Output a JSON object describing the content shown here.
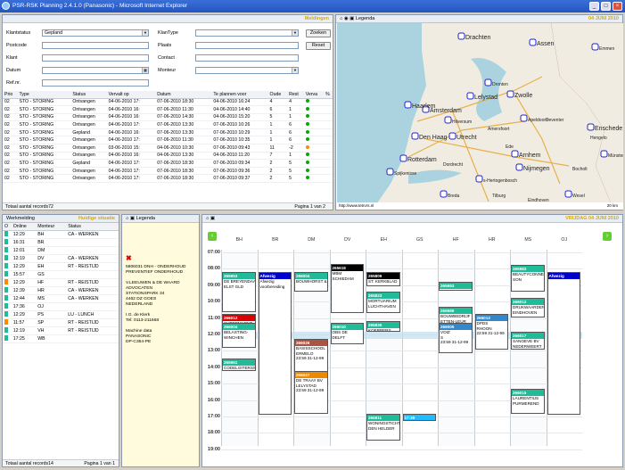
{
  "window": {
    "title": "PSR-RSK Planning 2.4.1.0 (Panasonic) - Microsoft Internet Explorer"
  },
  "search": {
    "meldingen": "Meldingen",
    "klantstatus_label": "Klantstatus",
    "klantstatus_value": "Gepland",
    "postcode_label": "Postcode",
    "klant_label": "Klant",
    "datum_label": "Datum",
    "refnr_label": "Ref.nr.",
    "klantype_label": "KlanType",
    "plaats_label": "Plaats",
    "contact_label": "Contact",
    "monteur_label": "Monteur",
    "zoeken": "Zoeken",
    "reset": "Reset"
  },
  "joblist": {
    "headers": [
      "Prio",
      "Type",
      "Status",
      "Vervalt op",
      "Datum",
      "Te plannen voor",
      "Oude",
      "Rest",
      "Verva",
      "%"
    ],
    "rows": [
      [
        "02",
        "STO - STORING",
        "Ontvangen",
        "04-06-2010 17:",
        "07-06-2010 18:30",
        "04-06-2010 16:24",
        "4",
        "4"
      ],
      [
        "02",
        "STO - STORING",
        "Ontvangen",
        "04-06-2010 16:",
        "07-06-2010 11:30",
        "04-06-2010 14:40",
        "6",
        "1"
      ],
      [
        "02",
        "STO - STORING",
        "Ontvangen",
        "04-06-2010 16:",
        "07-06-2010 14:30",
        "04-06-2010 15:20",
        "5",
        "1"
      ],
      [
        "02",
        "STO - STORING",
        "Ontvangen",
        "04-06-2010 17:",
        "07-06-2010 13:30",
        "07-06-2010 10:26",
        "1",
        "6"
      ],
      [
        "02",
        "STO - STORING",
        "Gepland",
        "04-06-2010 16:",
        "07-06-2010 13:30",
        "07-06-2010 10:29",
        "1",
        "6"
      ],
      [
        "02",
        "STO - STORING",
        "Ontvangen",
        "04-06-2010 17:",
        "07-06-2010 11:30",
        "07-06-2010 10:35",
        "1",
        "6"
      ],
      [
        "02",
        "STO - STORING",
        "Ontvangen",
        "03-06-2010 15:",
        "04-06-2010 10:30",
        "07-06-2010 09:43",
        "11",
        "-2"
      ],
      [
        "02",
        "STO - STORING",
        "Ontvangen",
        "04-06-2010 16:",
        "04-06-2010 13:30",
        "04-06-2010 11:20",
        "7",
        "1"
      ],
      [
        "02",
        "STO - STORING",
        "Gepland",
        "04-06-2010 17:",
        "07-06-2010 18:30",
        "07-06-2010 09:34",
        "2",
        "5"
      ],
      [
        "02",
        "STO - STORING",
        "Ontvangen",
        "04-06-2010 17:",
        "07-06-2010 18:30",
        "07-06-2010 09:36",
        "2",
        "5"
      ],
      [
        "02",
        "STO - STORING",
        "Ontvangen",
        "04-06-2010 17:",
        "07-06-2010 18:30",
        "07-06-2010 09:37",
        "2",
        "5"
      ]
    ],
    "dots": [
      "#0a0",
      "#0a0",
      "#0a0",
      "#0a0",
      "#0a0",
      "#0a0",
      "#f80",
      "#0a0",
      "#0a0",
      "#0a0",
      "#0a0"
    ],
    "footer": "Totaal aantal records72",
    "pager": "Pagina 1 van 2"
  },
  "map": {
    "date": "04 JUNI 2010",
    "legend": "Legenda",
    "status": "http://www.tetrvrs.nl",
    "scale": "20 km",
    "cities": [
      {
        "n": "Assen"
      },
      {
        "n": "Drachten"
      },
      {
        "n": "Zwolle"
      },
      {
        "n": "Lelystad"
      },
      {
        "n": "Amsterdam"
      },
      {
        "n": "Haarlem"
      },
      {
        "n": "Den Haag"
      },
      {
        "n": "Utrecht"
      },
      {
        "n": "Rotterdam"
      },
      {
        "n": "Arnhem"
      },
      {
        "n": "Nijmegen"
      },
      {
        "n": "Enschede"
      },
      {
        "n": "Apeldoorn"
      },
      {
        "n": "Deventer"
      },
      {
        "n": "Emmen"
      },
      {
        "n": "Hengelo"
      },
      {
        "n": "Münster"
      },
      {
        "n": "Dordrecht"
      },
      {
        "n": "s-Hertogenbosch"
      },
      {
        "n": "Tilburg"
      },
      {
        "n": "Breda"
      },
      {
        "n": "Eindhoven"
      },
      {
        "n": "Wesel"
      },
      {
        "n": "Bocholt"
      },
      {
        "n": "Spijkenisse"
      },
      {
        "n": "Ede"
      },
      {
        "n": "Dronten"
      },
      {
        "n": "Amersfoort"
      },
      {
        "n": "Hilversum"
      }
    ]
  },
  "engineers": {
    "title": "Werkmelding",
    "gold": "Huidige situatie",
    "headers": [
      "O",
      "Online",
      "Monteur",
      "Status"
    ],
    "rows": [
      [
        "12:29",
        "BH",
        "CA - WERKEN",
        "#2b9"
      ],
      [
        "16:31",
        "BR",
        "",
        "#2b9"
      ],
      [
        "12:01",
        "DM",
        "",
        "#2b9"
      ],
      [
        "12:19",
        "DV",
        "CA - WERKEN",
        "#2b9"
      ],
      [
        "12:29",
        "EH",
        "RT - REISTIJD",
        "#2b9"
      ],
      [
        "15:57",
        "GS",
        "",
        "#2b9"
      ],
      [
        "12:29",
        "HF",
        "RT - REISTIJD",
        "#f80"
      ],
      [
        "12:39",
        "HR",
        "CA - WERKEN",
        "#2b9"
      ],
      [
        "12:44",
        "MS",
        "CA - WERKEN",
        "#2b9"
      ],
      [
        "17:36",
        "OJ",
        "",
        "#2b9"
      ],
      [
        "12:29",
        "PS",
        "LU - LUNCH",
        "#2b9"
      ],
      [
        "11:57",
        "SP",
        "RT - REISTIJD",
        "#f80"
      ],
      [
        "12:19",
        "VH",
        "RT - REISTIJD",
        "#2b9"
      ],
      [
        "17:25",
        "WB",
        "",
        "#2b9"
      ]
    ],
    "footer": "Totaal aantal records14",
    "pager": "Pagina 1 van 1"
  },
  "detail": {
    "legend": "Legenda",
    "lines": [
      "5806031 DNH - ONDERHOUD",
      "PREVENTIEF ONDERHOUD",
      "",
      "V.LEEUWEN & DE WAARD",
      "ADVOCATEN",
      "STATIONSPARK 34",
      "4462 DZ GOES",
      "NEDERLAND",
      "",
      "I.G. de Klerk",
      "Tel: 0113-211668",
      "",
      "Machine data",
      "PANASONIC",
      "DP-C354-PE"
    ]
  },
  "calendar": {
    "date": "VRIJDAG 04 JUNI 2010",
    "columns": [
      "BH",
      "BR",
      "DM",
      "DV",
      "EH",
      "GS",
      "HF",
      "HR",
      "MS",
      "OJ"
    ],
    "hours": [
      "07:00",
      "08:00",
      "09:00",
      "10:00",
      "11:00",
      "12:00",
      "13:00",
      "14:00",
      "15:00",
      "16:00",
      "17:00",
      "18:00",
      "19:00"
    ],
    "tasks": [
      {
        "h": "265953",
        "c": "#2b9",
        "l": [
          "DE BREYENDAAL",
          "ELST GLD"
        ]
      },
      {
        "h": "266012",
        "c": "#d00",
        "l": [
          "SUPERMARKT"
        ]
      },
      {
        "h": "266004",
        "c": "#2b9",
        "l": [
          "BELASTING-",
          "WINCHEN"
        ]
      },
      {
        "h": "265961",
        "c": "#2b9",
        "l": [
          "CODELGITERSSE",
          "WINCHEN"
        ]
      },
      {
        "h": "Afwezig",
        "c": "#00c",
        "l": [
          "Afwezig",
          "voorbereiding"
        ]
      },
      {
        "h": "266004",
        "c": "#2b9",
        "l": [
          "BOUWHORST &"
        ]
      },
      {
        "h": "266026",
        "c": "#a54",
        "l": [
          "BASISSCHOOL",
          "ERMELO",
          "23:59 31-12-99"
        ]
      },
      {
        "h": "266027",
        "c": "#e80",
        "l": [
          "DE TRAAY BV",
          "LELYSTAD",
          "23:59 31-12-99"
        ]
      },
      {
        "h": "265618",
        "c": "#000",
        "l": [
          "MBM",
          "SCHIEDAM"
        ]
      },
      {
        "h": "266010",
        "c": "#2b9",
        "l": [
          "OBS DE",
          "DELFT"
        ]
      },
      {
        "h": "265809",
        "c": "#000",
        "l": [
          "ST. KERKBLAD"
        ]
      },
      {
        "h": "265823",
        "c": "#2b9",
        "l": [
          "MORTUARIUM",
          "LUCHTHAVEN"
        ]
      },
      {
        "h": "265835",
        "c": "#2b9",
        "l": [
          "KOERBERS"
        ]
      },
      {
        "h": "265811",
        "c": "#2b9",
        "l": [
          "WONINGSTICHT",
          "DEN HELDER"
        ]
      },
      {
        "h": "17:39",
        "c": "#2bf",
        "l": []
      },
      {
        "h": "265983",
        "c": "#2b9",
        "l": [
          "FA. RUEDA"
        ]
      },
      {
        "h": "265989",
        "c": "#2b9",
        "l": [
          "BOUWBEDRIJF",
          "ETTEN-LEUR"
        ]
      },
      {
        "h": "266005",
        "c": "#38c",
        "l": [
          "VOIZ",
          "S",
          "23:59 31-12-99"
        ]
      },
      {
        "h": "266013",
        "c": "#38c",
        "l": [
          "DPDS",
          "RHOON",
          "23:59 31-12-99"
        ]
      },
      {
        "h": "265983",
        "c": "#2b9",
        "l": [
          "BEAUTYCONNEC",
          "SON"
        ]
      },
      {
        "h": "266012",
        "c": "#2b9",
        "l": [
          "DRUKWAARDEN",
          "EINDHOVEN"
        ]
      },
      {
        "h": "266017",
        "c": "#2b9",
        "l": [
          "SANOEVE BV",
          "NEDERWEERT"
        ]
      },
      {
        "h": "266015",
        "c": "#2b9",
        "l": [
          "LAURENTIUS",
          "PURMEREND"
        ]
      },
      {
        "h": "Afwezig",
        "c": "#00c",
        "l": []
      }
    ]
  }
}
